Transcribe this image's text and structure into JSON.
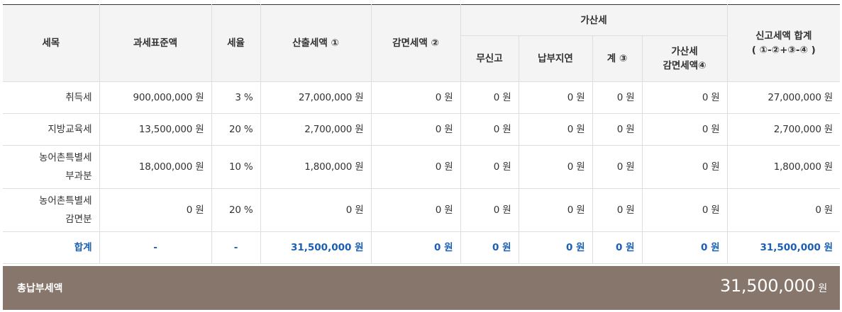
{
  "table": {
    "headers": {
      "item": "세목",
      "base": "과세표준액",
      "rate": "세율",
      "calc": "산출세액 ①",
      "reduction": "감면세액 ②",
      "penalty_group": "가산세",
      "penalty_no_report": "무신고",
      "penalty_late_pay": "납부지연",
      "penalty_sum": "계 ③",
      "penalty_reduction_line1": "가산세",
      "penalty_reduction_line2": "감면세액④",
      "report_total_line1": "신고세액 합계",
      "report_total_line2": "( ①-②+③-④ )"
    },
    "rows": [
      {
        "item": "취득세",
        "base": "900,000,000 원",
        "rate": "3 %",
        "calc": "27,000,000 원",
        "reduction": "0 원",
        "no_report": "0 원",
        "late_pay": "0 원",
        "penalty_sum": "0 원",
        "penalty_reduction": "0 원",
        "report_total": "27,000,000 원"
      },
      {
        "item": "지방교육세",
        "base": "13,500,000 원",
        "rate": "20 %",
        "calc": "2,700,000 원",
        "reduction": "0 원",
        "no_report": "0 원",
        "late_pay": "0 원",
        "penalty_sum": "0 원",
        "penalty_reduction": "0 원",
        "report_total": "2,700,000 원"
      },
      {
        "item_line1": "농어촌특별세",
        "item_line2": "부과분",
        "base": "18,000,000 원",
        "rate": "10 %",
        "calc": "1,800,000 원",
        "reduction": "0 원",
        "no_report": "0 원",
        "late_pay": "0 원",
        "penalty_sum": "0 원",
        "penalty_reduction": "0 원",
        "report_total": "1,800,000 원"
      },
      {
        "item_line1": "농어촌특별세",
        "item_line2": "감면분",
        "base": "0 원",
        "rate": "20 %",
        "calc": "0 원",
        "reduction": "0 원",
        "no_report": "0 원",
        "late_pay": "0 원",
        "penalty_sum": "0 원",
        "penalty_reduction": "0 원",
        "report_total": "0 원"
      }
    ],
    "total": {
      "item": "합계",
      "base": "-",
      "rate": "-",
      "calc": "31,500,000 원",
      "reduction": "0 원",
      "no_report": "0 원",
      "late_pay": "0 원",
      "penalty_sum": "0 원",
      "penalty_reduction": "0 원",
      "report_total": "31,500,000 원"
    }
  },
  "grand_total": {
    "label": "총납부세액",
    "amount": "31,500,000",
    "unit": "원"
  },
  "colors": {
    "total_text": "#1a5fb4",
    "grand_bar": "#87766c",
    "header_bg": "#f4f4f4"
  }
}
